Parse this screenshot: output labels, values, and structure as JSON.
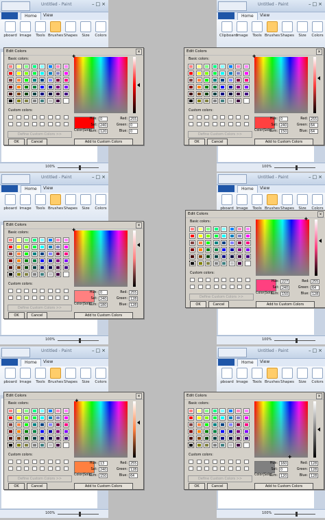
{
  "app": {
    "title": "Untitled - Paint",
    "tabs": [
      "Home",
      "View"
    ],
    "ribbon_groups": [
      {
        "label": "Clipboard",
        "icon": "clipboard-icon"
      },
      {
        "label": "Image",
        "icon": "image-icon"
      },
      {
        "label": "Tools",
        "icon": "tools-icon"
      },
      {
        "label": "Brushes",
        "icon": "brush-icon"
      },
      {
        "label": "Shapes",
        "icon": "shapes-icon"
      },
      {
        "label": "Size",
        "icon": "size-icon"
      },
      {
        "label": "Colors",
        "icon": "palette-icon"
      }
    ],
    "ribbon_labels_visible": [
      "pboard",
      "Image",
      "Tools",
      "Brushes",
      "Shapes",
      "Size",
      "Colors"
    ],
    "ribbon_labels_visible_right_first": [
      "Clipboard",
      "Image",
      "Tools",
      "Brushes",
      "Shapes",
      "Size",
      "Colors"
    ],
    "zoom": "100%"
  },
  "dialog": {
    "title": "Edit Colors",
    "basic_label": "Basic colors:",
    "custom_label": "Custom colors:",
    "define_label": "Define Custom Colors >>",
    "ok_label": "OK",
    "cancel_label": "Cancel",
    "add_label": "Add to Custom Colors",
    "colorsolid_label": "Color|Solid",
    "hue_label": "Hue:",
    "sat_label": "Sat:",
    "lum_label": "Lum:",
    "red_label": "Red:",
    "green_label": "Green:",
    "blue_label": "Blue:"
  },
  "basic_colors": [
    "#ff8080",
    "#ffff80",
    "#80ff80",
    "#00ff80",
    "#80ffff",
    "#0080ff",
    "#ff80c0",
    "#ff80ff",
    "#ff0000",
    "#ffff00",
    "#80ff00",
    "#00ff40",
    "#00ffff",
    "#0080c0",
    "#8080c0",
    "#ff00ff",
    "#804040",
    "#ff8040",
    "#00ff00",
    "#008080",
    "#004080",
    "#8080ff",
    "#800040",
    "#ff0080",
    "#800000",
    "#ff8000",
    "#008000",
    "#008040",
    "#0000ff",
    "#0000a0",
    "#800080",
    "#8000ff",
    "#400000",
    "#804000",
    "#004000",
    "#004040",
    "#000080",
    "#000040",
    "#400040",
    "#400080",
    "#000000",
    "#808000",
    "#808040",
    "#808080",
    "#408080",
    "#c0c0c0",
    "#400040",
    "#ffffff"
  ],
  "screenshots": [
    {
      "side": "left",
      "hue": "0",
      "sat": "240",
      "lum": "120",
      "red": "255",
      "green": "0",
      "blue": "0",
      "preview": "#ff0000"
    },
    {
      "side": "right",
      "hue": "0",
      "sat": "240",
      "lum": "150",
      "red": "255",
      "green": "64",
      "blue": "64",
      "preview": "#ff4040"
    },
    {
      "side": "left",
      "hue": "0",
      "sat": "240",
      "lum": "180",
      "red": "255",
      "green": "128",
      "blue": "128",
      "preview": "#ff8080"
    },
    {
      "side": "right",
      "hue": "227",
      "sat": "240",
      "lum": "150",
      "red": "255",
      "green": "64",
      "blue": "128",
      "preview": "#ff4080"
    },
    {
      "side": "left",
      "hue": "13",
      "sat": "240",
      "lum": "150",
      "red": "255",
      "green": "128",
      "blue": "64",
      "preview": "#ff8040"
    },
    {
      "side": "right",
      "hue": "160",
      "sat": "0",
      "lum": "120",
      "red": "128",
      "green": "128",
      "blue": "128",
      "preview": "#808080"
    }
  ]
}
